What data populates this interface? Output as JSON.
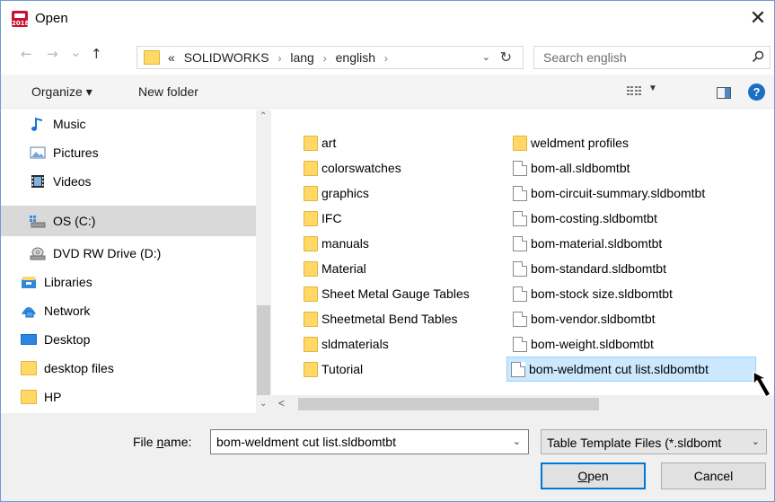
{
  "window": {
    "title": "Open",
    "close_glyph": "✕"
  },
  "nav_buttons": {
    "back": "←",
    "forward": "→",
    "recent": "⌄",
    "up": "↑"
  },
  "address": {
    "prefix": "«",
    "crumbs": [
      "SOLIDWORKS",
      "lang",
      "english"
    ],
    "separator": "›",
    "dropdown_glyph": "⌄",
    "refresh_glyph": "↻"
  },
  "search": {
    "placeholder": "Search english"
  },
  "toolbar": {
    "organize_label": "Organize ▾",
    "new_folder_label": "New folder",
    "view_dropdown": "▼",
    "help_label": "?"
  },
  "nav_pane": {
    "items": [
      {
        "label": "Music",
        "icon": "music-icon",
        "selected": false
      },
      {
        "label": "Pictures",
        "icon": "pictures-icon",
        "selected": false
      },
      {
        "label": "Videos",
        "icon": "videos-icon",
        "selected": false
      },
      {
        "label": "OS (C:)",
        "icon": "drive-icon",
        "selected": true
      },
      {
        "label": "DVD RW Drive (D:)",
        "icon": "dvd-drive-icon",
        "selected": false
      },
      {
        "label": "Libraries",
        "icon": "libraries-icon",
        "selected": false
      },
      {
        "label": "Network",
        "icon": "network-icon",
        "selected": false
      },
      {
        "label": "Desktop",
        "icon": "desktop-icon",
        "selected": false
      },
      {
        "label": "desktop files",
        "icon": "folder-icon",
        "selected": false
      },
      {
        "label": "HP",
        "icon": "folder-icon",
        "selected": false
      }
    ],
    "scroll_up": "⌃",
    "scroll_down": "⌄"
  },
  "files": {
    "column1": [
      {
        "name": "art",
        "type": "folder"
      },
      {
        "name": "colorswatches",
        "type": "folder"
      },
      {
        "name": "graphics",
        "type": "folder"
      },
      {
        "name": "IFC",
        "type": "folder"
      },
      {
        "name": "manuals",
        "type": "folder"
      },
      {
        "name": "Material",
        "type": "folder"
      },
      {
        "name": "Sheet Metal Gauge Tables",
        "type": "folder"
      },
      {
        "name": "Sheetmetal Bend Tables",
        "type": "folder"
      },
      {
        "name": "sldmaterials",
        "type": "folder"
      },
      {
        "name": "Tutorial",
        "type": "folder"
      }
    ],
    "column2": [
      {
        "name": "weldment profiles",
        "type": "folder"
      },
      {
        "name": "bom-all.sldbomtbt",
        "type": "file"
      },
      {
        "name": "bom-circuit-summary.sldbomtbt",
        "type": "file"
      },
      {
        "name": "bom-costing.sldbomtbt",
        "type": "file"
      },
      {
        "name": "bom-material.sldbomtbt",
        "type": "file"
      },
      {
        "name": "bom-standard.sldbomtbt",
        "type": "file"
      },
      {
        "name": "bom-stock size.sldbomtbt",
        "type": "file"
      },
      {
        "name": "bom-vendor.sldbomtbt",
        "type": "file"
      },
      {
        "name": "bom-weight.sldbomtbt",
        "type": "file"
      },
      {
        "name": "bom-weldment cut list.sldbomtbt",
        "type": "file",
        "selected": true
      }
    ],
    "hscroll_left": "<"
  },
  "bottom": {
    "file_name_label_pre": "File ",
    "file_name_label_u": "n",
    "file_name_label_post": "ame:",
    "file_name_value": "bom-weldment cut list.sldbomtbt",
    "file_name_dropdown": "⌄",
    "file_type": "Table Template Files (*.sldbomt",
    "file_type_dropdown": "⌄",
    "open_label_u": "O",
    "open_label_rest": "pen",
    "cancel_label": "Cancel"
  }
}
